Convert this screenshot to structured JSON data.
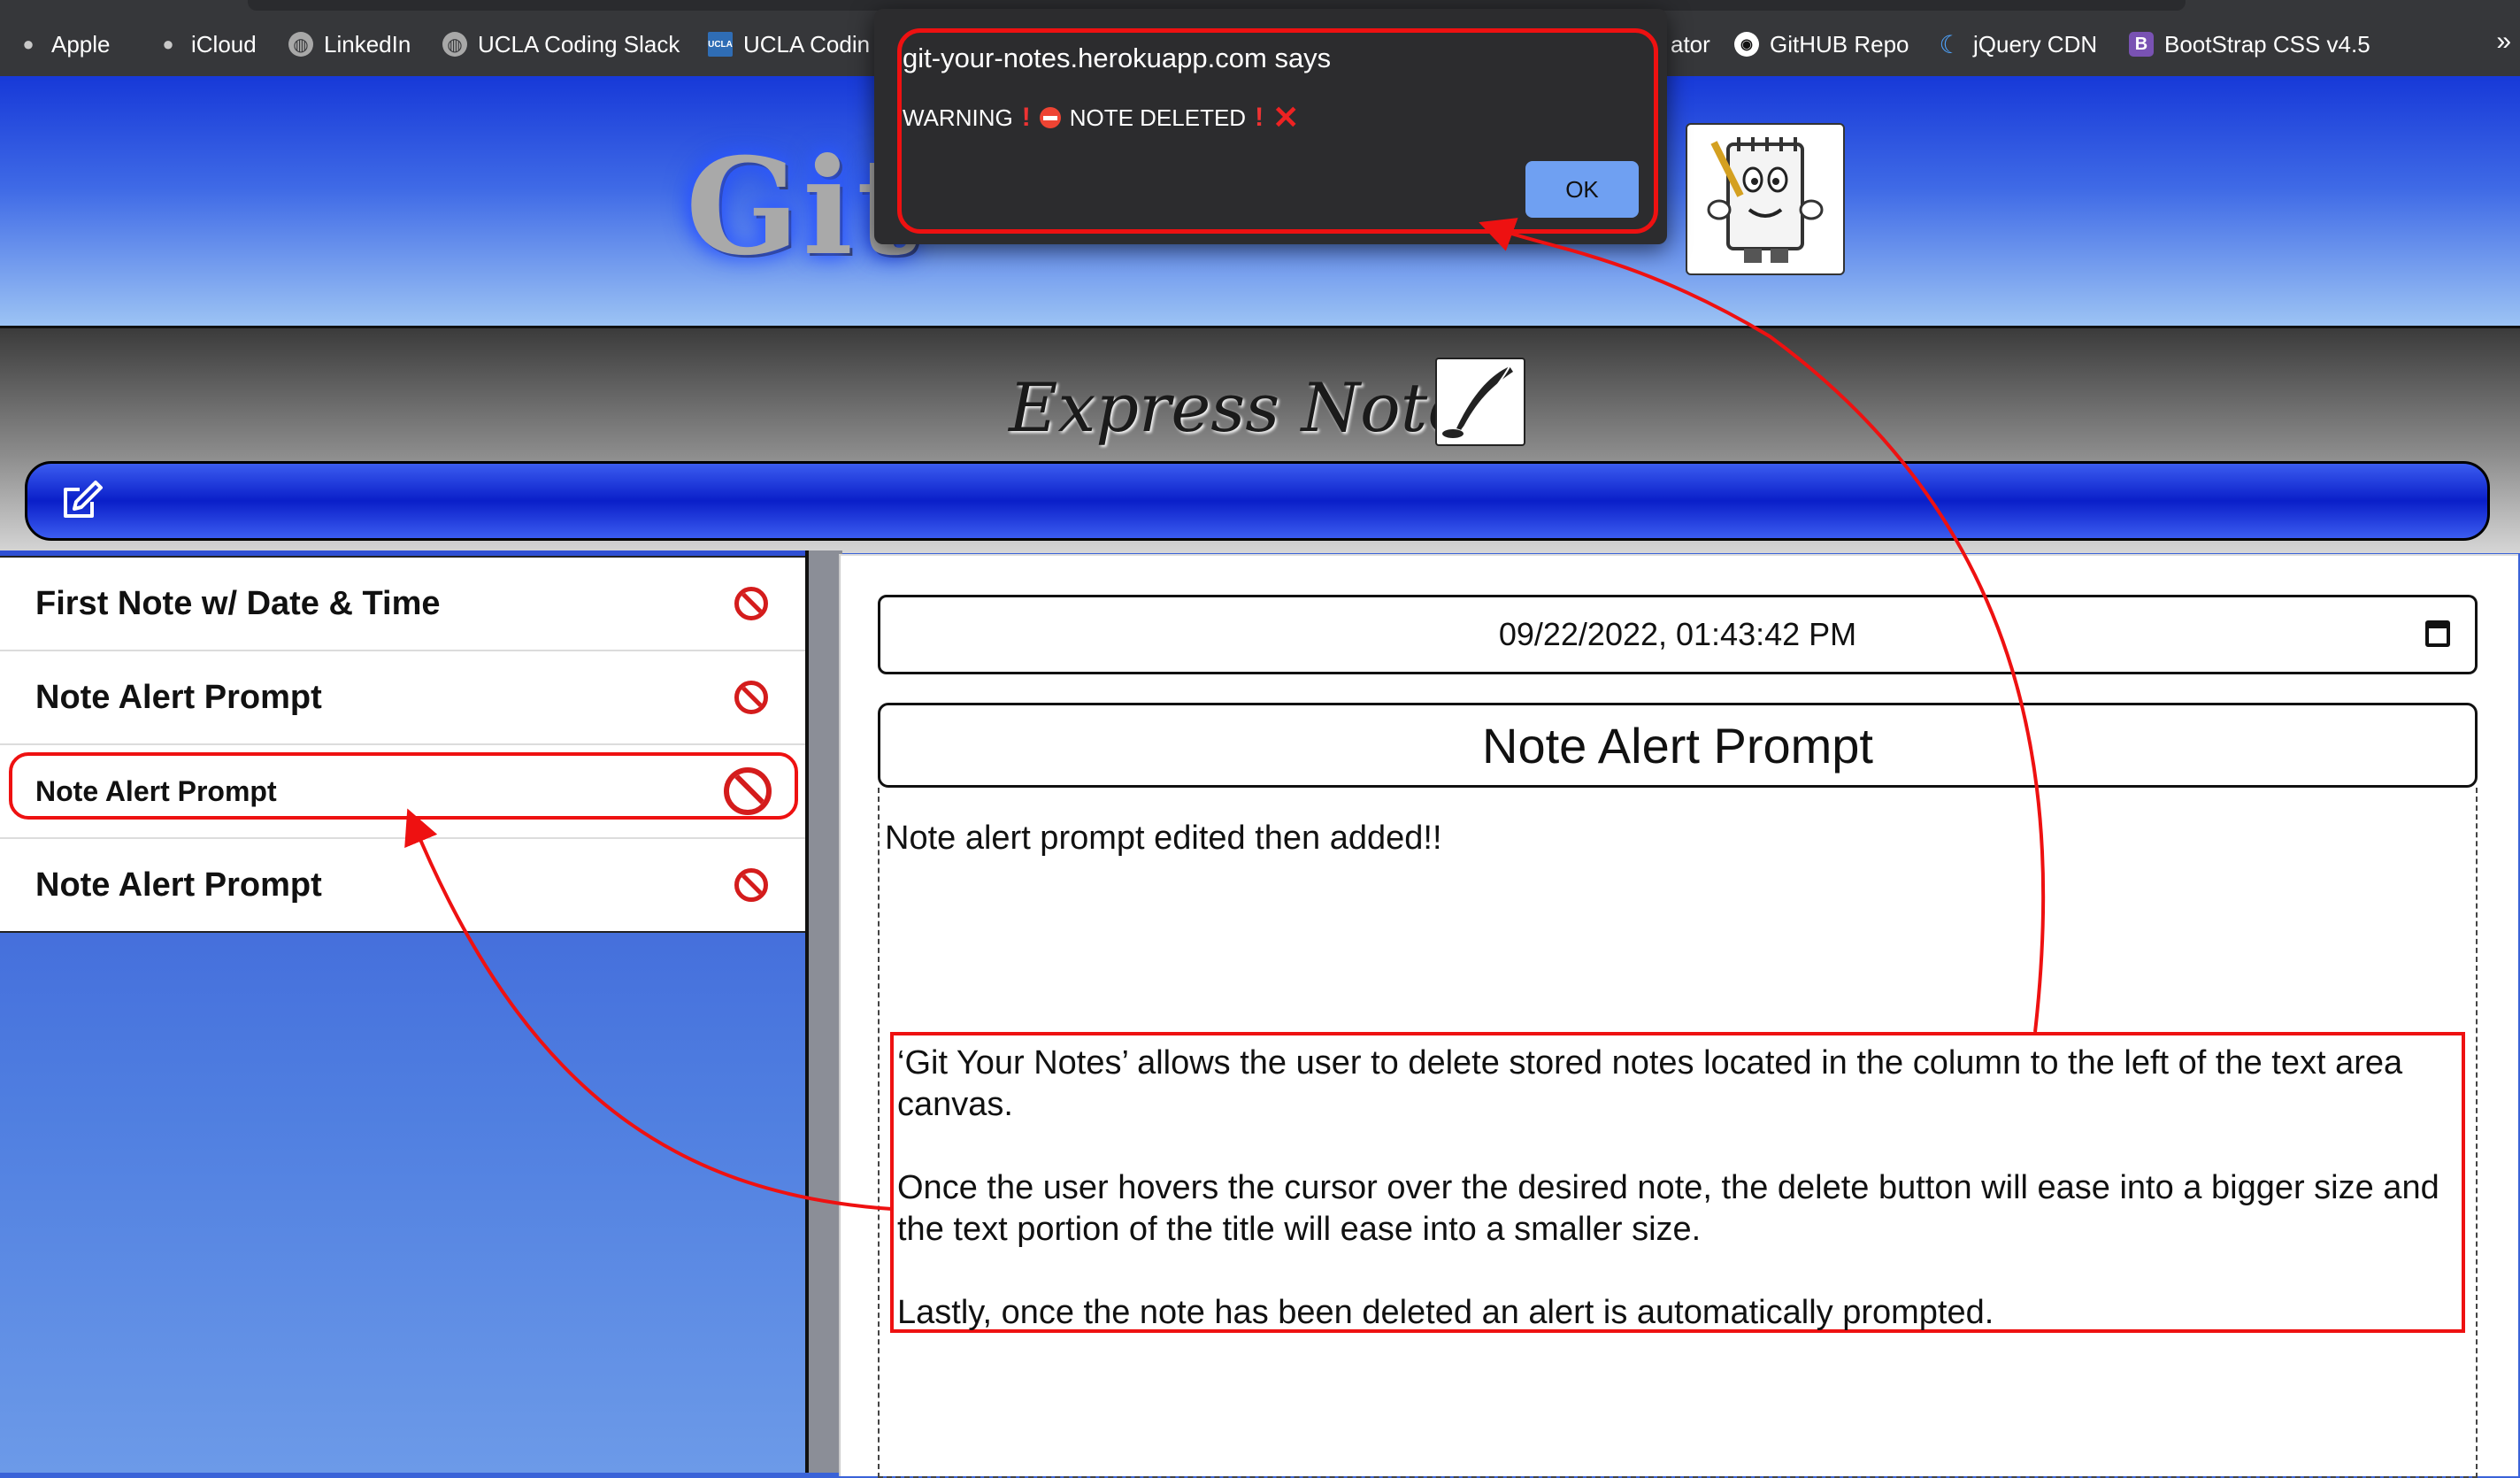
{
  "bookmarks": [
    {
      "label": "Apple",
      "icon": "apple-icon"
    },
    {
      "label": "iCloud",
      "icon": "apple-icon"
    },
    {
      "label": "LinkedIn",
      "icon": "globe-icon"
    },
    {
      "label": "UCLA Coding Slack",
      "icon": "globe-icon"
    },
    {
      "label": "UCLA Codin",
      "icon": "ucla-icon"
    },
    {
      "label": "ator",
      "icon": ""
    },
    {
      "label": "GitHUB Repo",
      "icon": "github-icon"
    },
    {
      "label": "jQuery CDN",
      "icon": "jquery-icon"
    },
    {
      "label": "BootStrap CSS v4.5",
      "icon": "bootstrap-icon"
    }
  ],
  "more_chevron": "»",
  "header": {
    "logo_text": "Git",
    "mascot_icon": "notepad-mascot-icon"
  },
  "title_band": {
    "title": "Express Notes",
    "quill_icon": "quill-icon",
    "new_note_icon": "edit-icon"
  },
  "notes": [
    {
      "title": "First Note w/ Date & Time"
    },
    {
      "title": "Note Alert Prompt"
    },
    {
      "title": "Note Alert Prompt"
    },
    {
      "title": "Note Alert Prompt"
    }
  ],
  "editor": {
    "date_value": "09/22/2022, 01:43:42 PM",
    "title_value": "Note Alert Prompt",
    "text_value": "Note alert prompt edited then added!!"
  },
  "annotation": {
    "p1": "‘Git Your Notes’ allows the user to delete stored notes located in the column to the left of the text area canvas.",
    "p2": "Once the user hovers the cursor over the desired note, the delete button will ease into a bigger size and the text portion of the title will ease into a smaller size.",
    "p3": "Lastly, once the note has been deleted an alert is automatically prompted."
  },
  "dialog": {
    "origin": "git-your-notes.herokuapp.com says",
    "warning": "WARNING",
    "message": "NOTE DELETED",
    "ok_label": "OK"
  },
  "colors": {
    "accent_red": "#e11111",
    "nav_blue": "#0a1fc9",
    "dialog_bg": "#2c2c2e",
    "ok_blue": "#6fa0f2"
  }
}
